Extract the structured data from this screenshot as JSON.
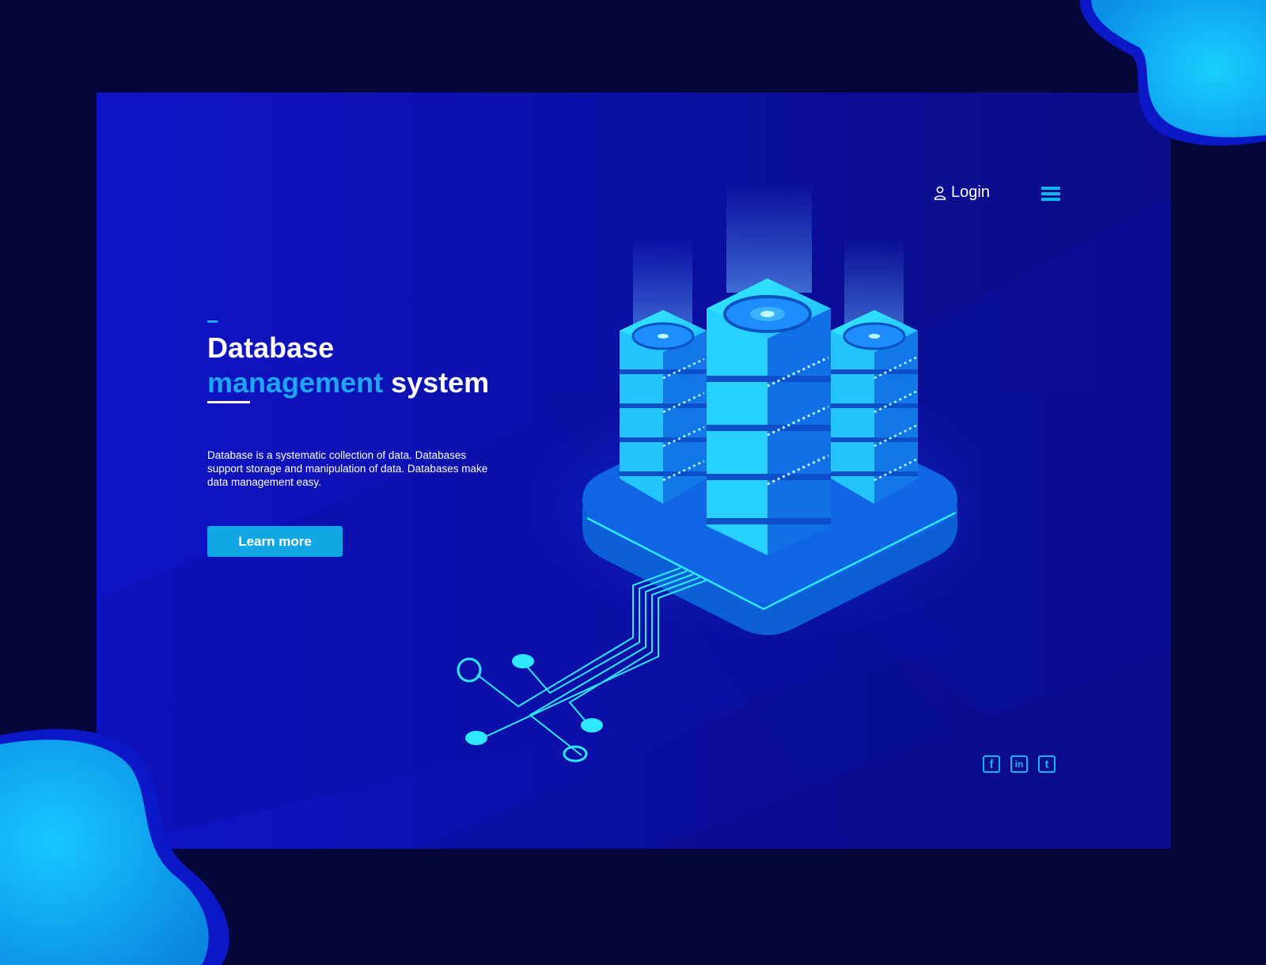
{
  "nav": {
    "login_label": "Login"
  },
  "hero": {
    "title_line1": "Database",
    "title_accent": "management",
    "title_rest": " system",
    "description": "Database is a systematic collection of data. Databases support storage and manipulation of data. Databases make data management easy.",
    "cta_label": "Learn more"
  },
  "social": [
    {
      "icon": "facebook-icon",
      "glyph": "f"
    },
    {
      "icon": "linkedin-icon",
      "glyph": "in"
    },
    {
      "icon": "twitter-icon",
      "glyph": "t"
    }
  ],
  "colors": {
    "background": "#05063a",
    "panel": "#0f14c8",
    "accent": "#1fa6f0",
    "button": "#13a6e4",
    "server_glow": "#2ee8ff"
  }
}
